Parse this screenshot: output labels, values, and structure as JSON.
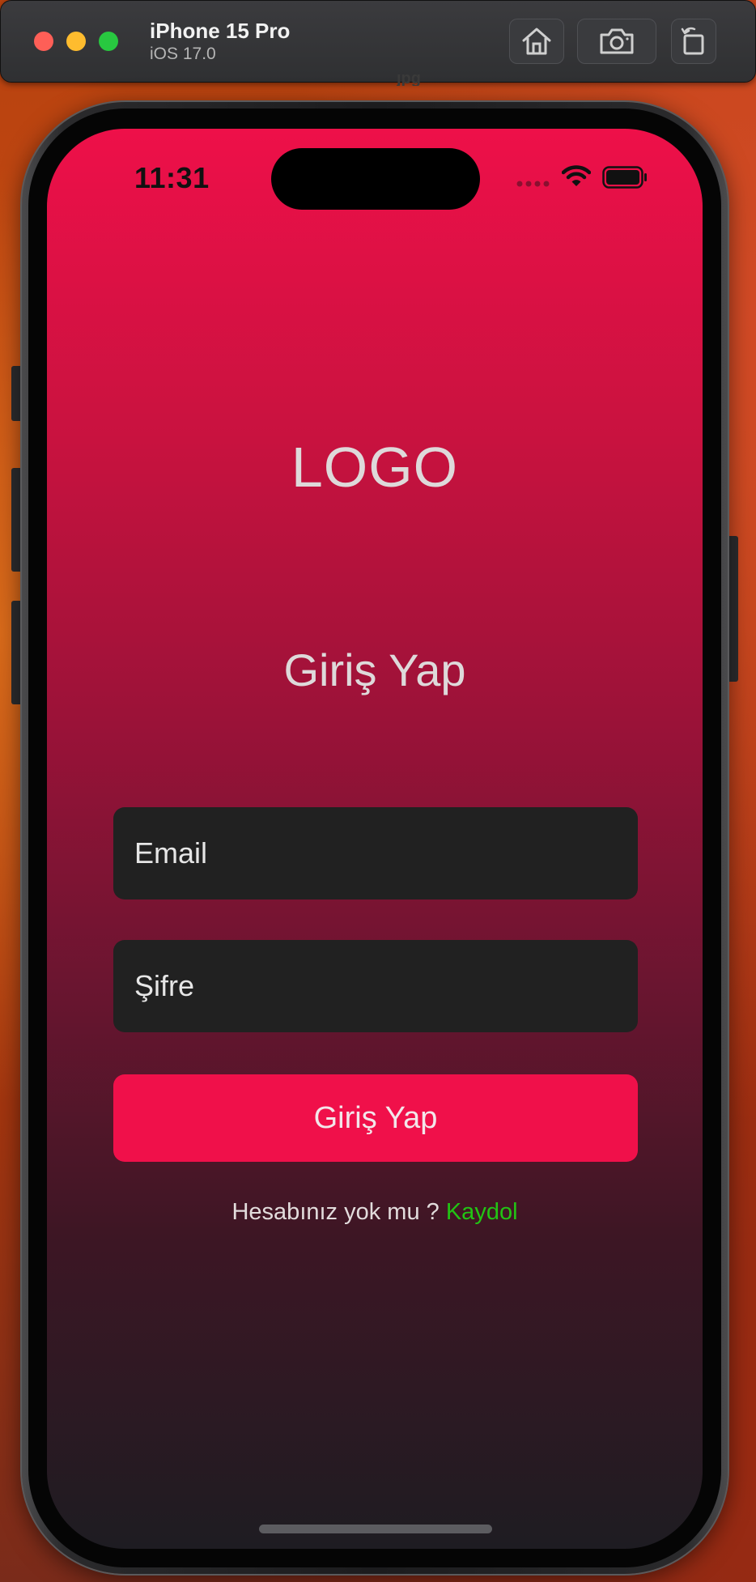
{
  "simulator": {
    "device_name": "iPhone 15 Pro",
    "os_version": "iOS 17.0",
    "file_tag": "jpg",
    "icons": [
      "home-icon",
      "screenshot-icon",
      "rotate-icon"
    ]
  },
  "status_bar": {
    "time": "11:31",
    "icons": [
      "signal-dots-icon",
      "wifi-icon",
      "battery-icon"
    ]
  },
  "screen": {
    "logo": "LOGO",
    "title": "Giriş Yap",
    "email_placeholder": "Email",
    "password_placeholder": "Şifre",
    "login_button": "Giriş Yap",
    "signup_question": "Hesabınız yok mu ?",
    "signup_link": "Kaydol"
  },
  "colors": {
    "gradient_top": "#ee1049",
    "gradient_bottom": "#1e1c22",
    "field_bg": "#212121",
    "button_bg": "#f0104a",
    "link": "#22c414",
    "text": "#ded9da"
  }
}
